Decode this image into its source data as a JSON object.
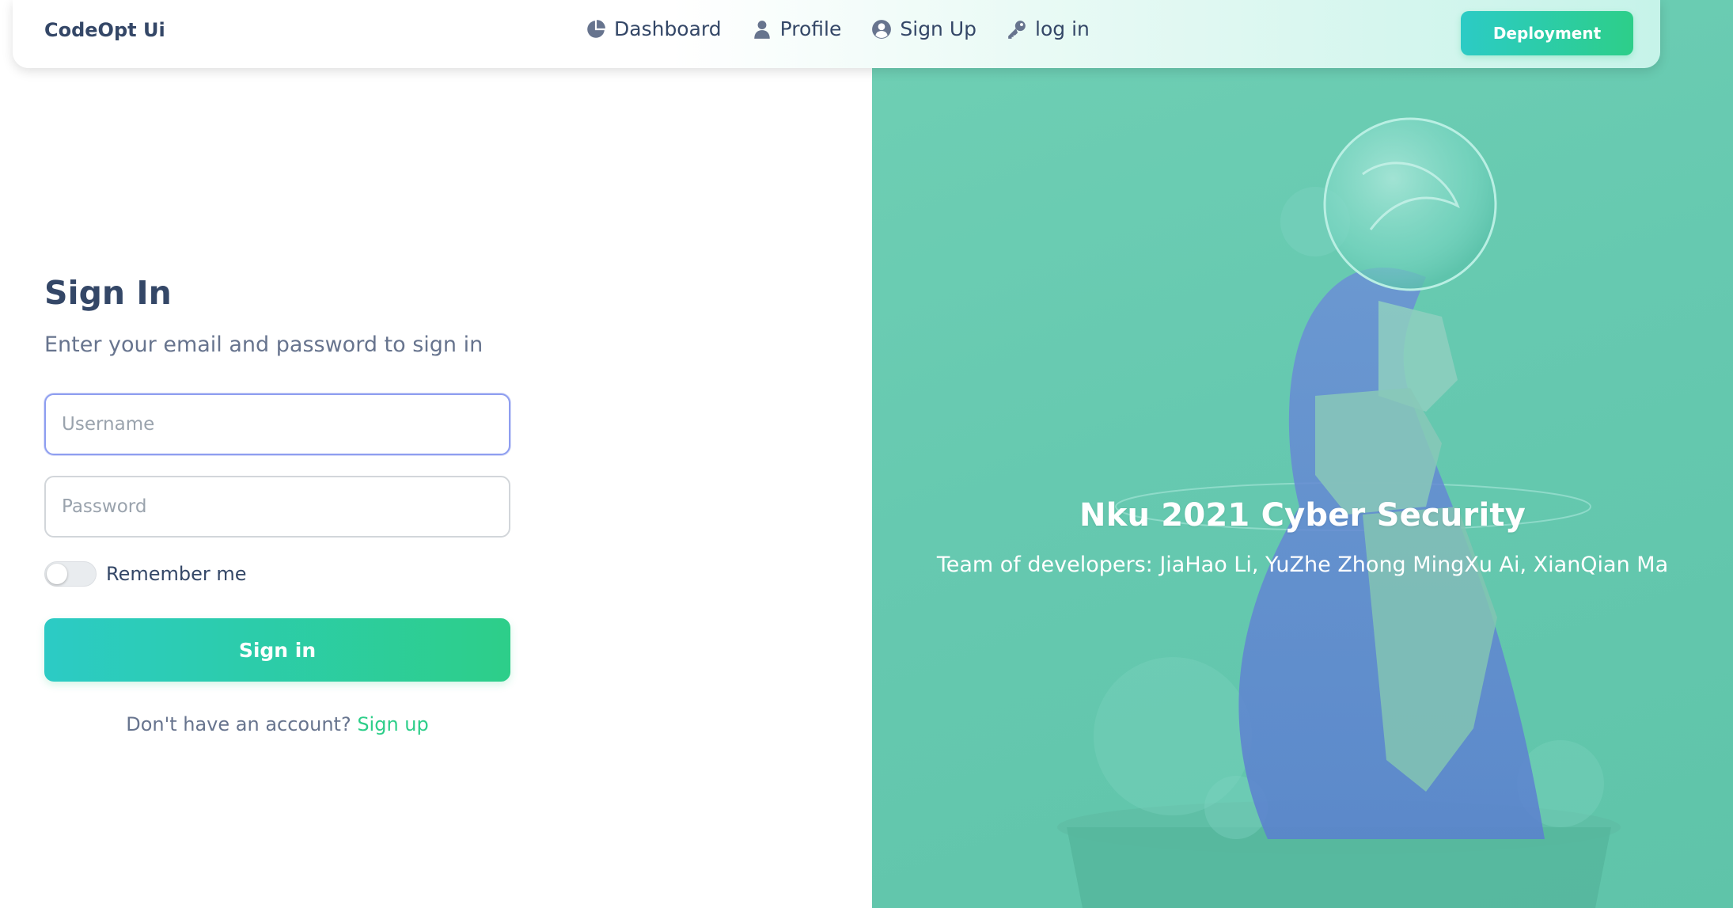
{
  "navbar": {
    "brand": "CodeOpt Ui",
    "items": [
      {
        "label": "Dashboard",
        "icon": "pie-chart-icon"
      },
      {
        "label": "Profile",
        "icon": "user-icon"
      },
      {
        "label": "Sign Up",
        "icon": "user-circle-icon"
      },
      {
        "label": "log in",
        "icon": "key-icon"
      }
    ],
    "deploy_label": "Deployment"
  },
  "form": {
    "title": "Sign In",
    "subtitle": "Enter your email and password to sign in",
    "username_placeholder": "Username",
    "password_placeholder": "Password",
    "remember_label": "Remember me",
    "remember_checked": false,
    "submit_label": "Sign in",
    "footer_text": "Don't have an account? ",
    "footer_link": "Sign up"
  },
  "hero": {
    "title": "Nku 2021 Cyber Security",
    "subtitle": "Team of developers: JiaHao Li, YuZhe Zhong MingXu Ai, XianQian Ma"
  },
  "colors": {
    "accent_start": "#2ccbc5",
    "accent_end": "#2dce89",
    "text_dark": "#344767",
    "text_muted": "#67748e",
    "hero_tint": "#66c9b0"
  }
}
